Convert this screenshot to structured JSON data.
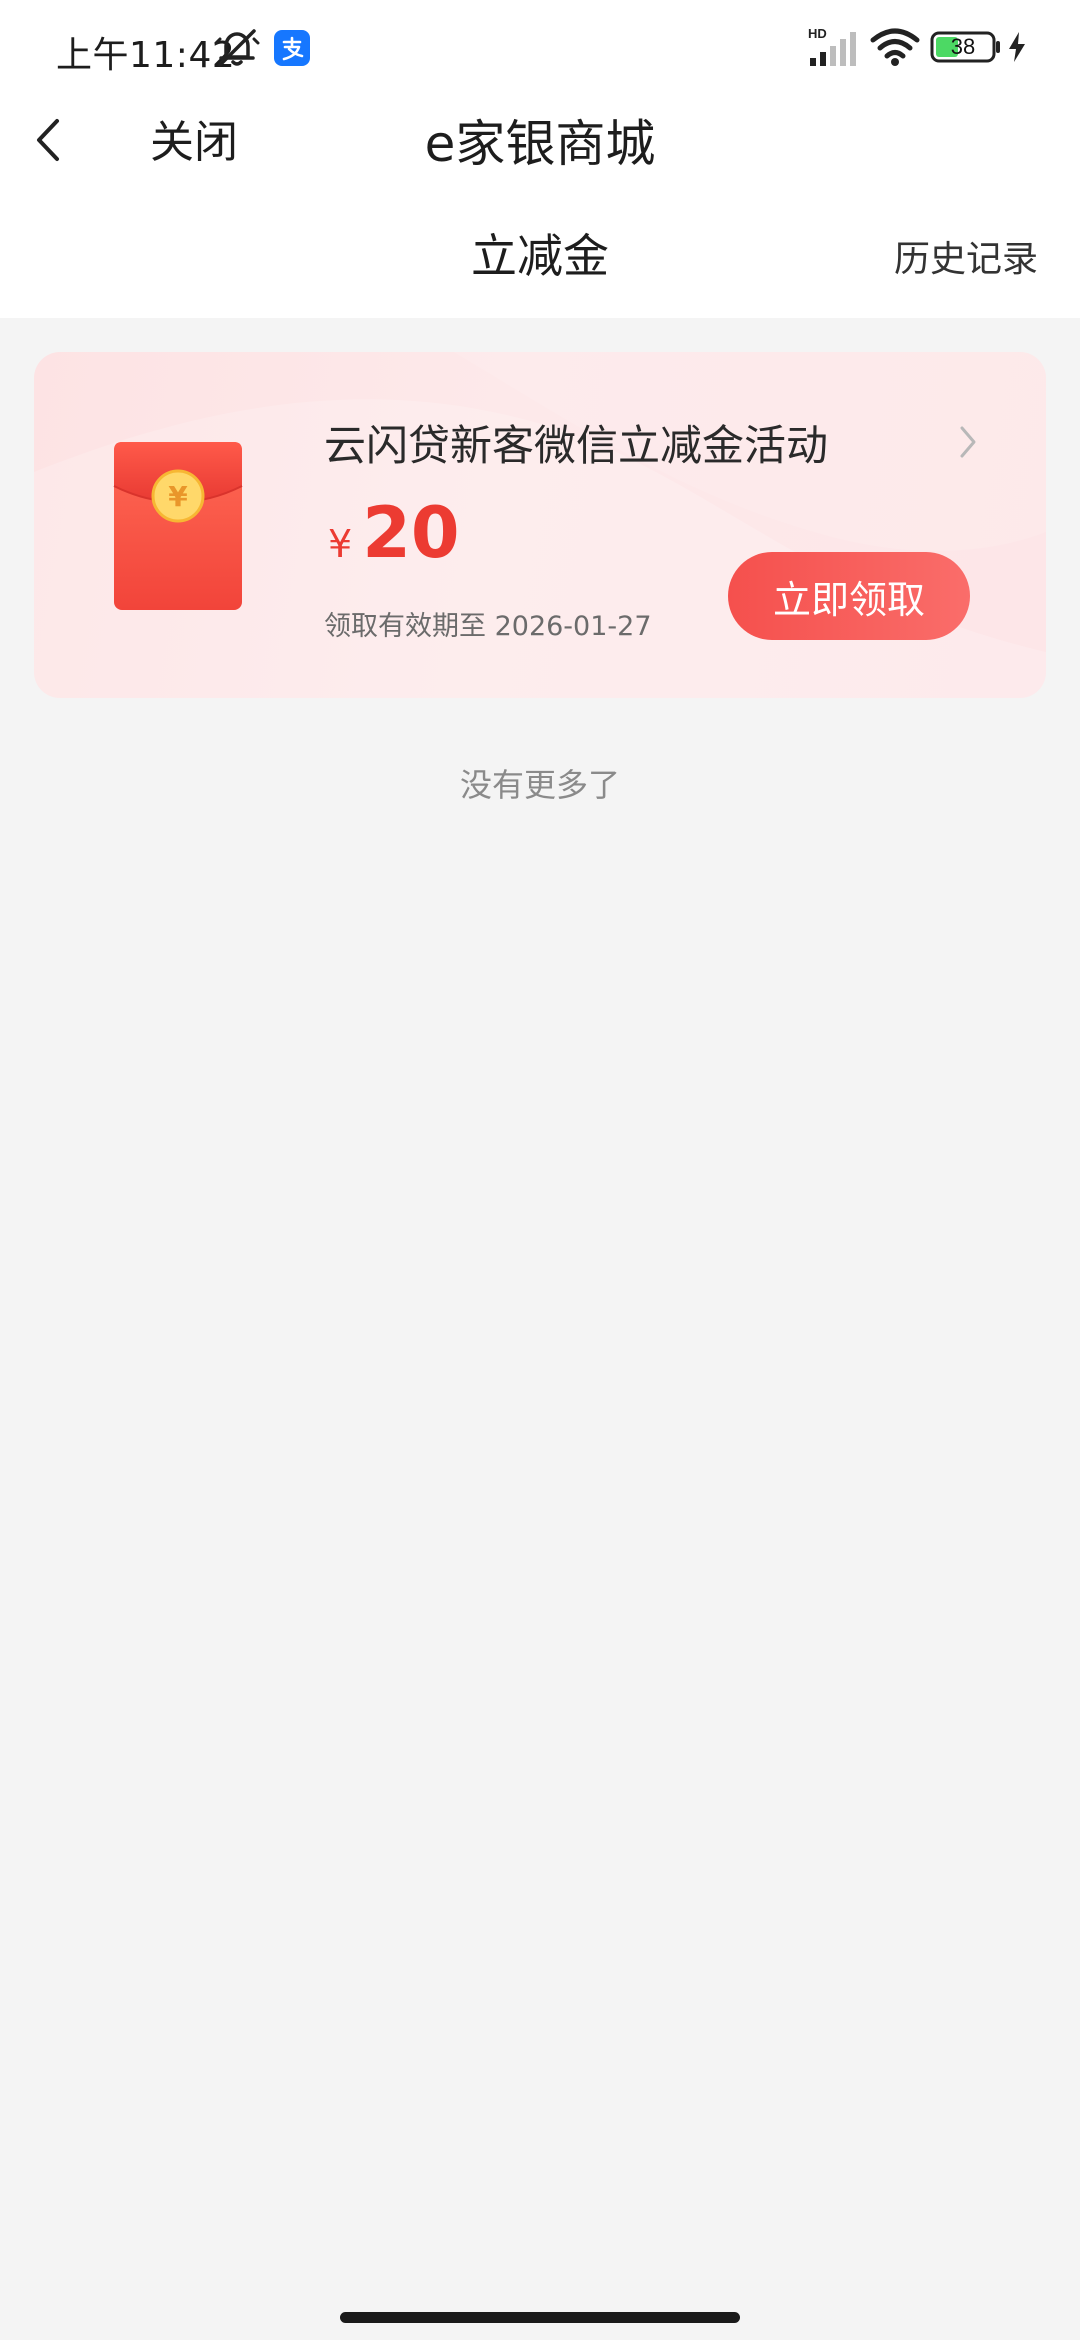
{
  "status_bar": {
    "time": "上午11:42",
    "battery": "38",
    "signal_label": "HD"
  },
  "nav": {
    "close_label": "关闭",
    "title": "e家银商城",
    "page_title": "立减金",
    "history_label": "历史记录"
  },
  "coupon": {
    "title": "云闪贷新客微信立减金活动",
    "currency": "¥",
    "amount": "20",
    "expiry": "领取有效期至 2026-01-27",
    "claim_label": "立即领取",
    "envelope_symbol": "¥"
  },
  "footer": {
    "no_more": "没有更多了"
  },
  "colors": {
    "accent": "#ec3b32",
    "button": "#f5504d",
    "card_bg": "#fde6e8",
    "page_bg": "#f4f4f4"
  }
}
